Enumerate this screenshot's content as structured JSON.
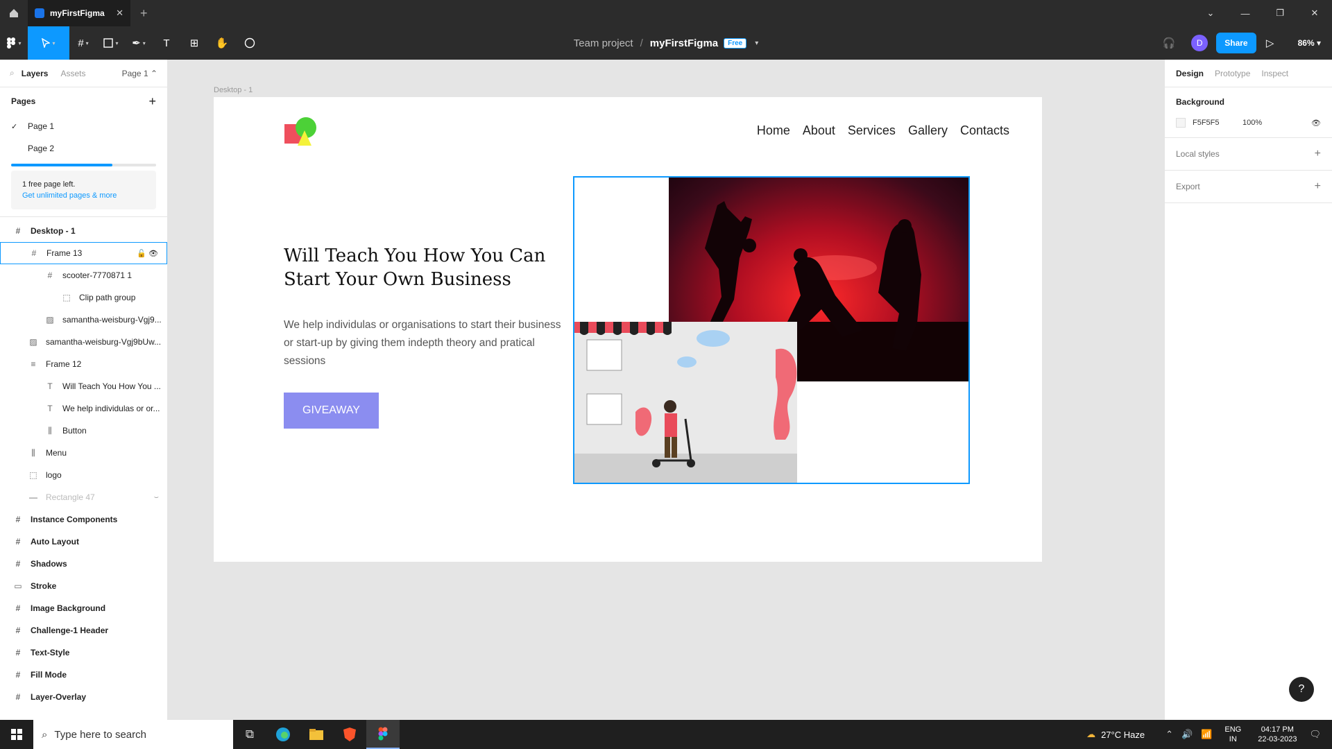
{
  "tabbar": {
    "tab_title": "myFirstFigma",
    "close": "✕",
    "add": "+"
  },
  "toolbar": {
    "breadcrumb_team": "Team project",
    "separator": "/",
    "file_name": "myFirstFigma",
    "badge": "Free",
    "avatar_initial": "D",
    "share_label": "Share",
    "zoom": "86%"
  },
  "left_panel": {
    "tabs": {
      "layers": "Layers",
      "assets": "Assets",
      "page_selector": "Page 1 ⌃"
    },
    "pages_header": "Pages",
    "pages": [
      {
        "label": "Page 1",
        "selected": true
      },
      {
        "label": "Page 2",
        "selected": false
      }
    ],
    "upgrade_note": "1 free page left.",
    "upgrade_link": "Get unlimited pages & more",
    "layers": [
      {
        "label": "Desktop - 1"
      },
      {
        "label": "Frame 13"
      },
      {
        "label": "scooter-7770871 1"
      },
      {
        "label": "Clip path group"
      },
      {
        "label": "samantha-weisburg-Vgj9..."
      },
      {
        "label": "samantha-weisburg-Vgj9bUw..."
      },
      {
        "label": "Frame 12"
      },
      {
        "label": "Will Teach You How You ..."
      },
      {
        "label": "We help individulas or or..."
      },
      {
        "label": "Button"
      },
      {
        "label": "Menu"
      },
      {
        "label": "logo"
      },
      {
        "label": "Rectangle 47"
      },
      {
        "label": "Instance Components"
      },
      {
        "label": "Auto Layout"
      },
      {
        "label": "Shadows"
      },
      {
        "label": "Stroke"
      },
      {
        "label": "Image Background"
      },
      {
        "label": "Challenge-1 Header"
      },
      {
        "label": "Text-Style"
      },
      {
        "label": "Fill Mode"
      },
      {
        "label": "Layer-Overlay"
      }
    ]
  },
  "canvas": {
    "frame_label": "Desktop - 1",
    "nav": [
      "Home",
      "About",
      "Services",
      "Gallery",
      "Contacts"
    ],
    "headline": "Will Teach You How You Can Start Your Own Business",
    "description": "We help individulas or organisations to start their business or start-up by giving them indepth theory and pratical sessions",
    "button": "GIVEAWAY"
  },
  "right_panel": {
    "tabs": [
      "Design",
      "Prototype",
      "Inspect"
    ],
    "background_header": "Background",
    "bg_hex": "F5F5F5",
    "bg_opacity": "100%",
    "local_styles": "Local styles",
    "export": "Export",
    "help": "?"
  },
  "taskbar": {
    "search_placeholder": "Type here to search",
    "weather": "27°C  Haze",
    "lang_top": "ENG",
    "lang_bottom": "IN",
    "time": "04:17 PM",
    "date": "22-03-2023"
  },
  "colors": {
    "accent": "#0d99ff",
    "button": "#8b8df0",
    "toolbar": "#2c2c2c"
  }
}
